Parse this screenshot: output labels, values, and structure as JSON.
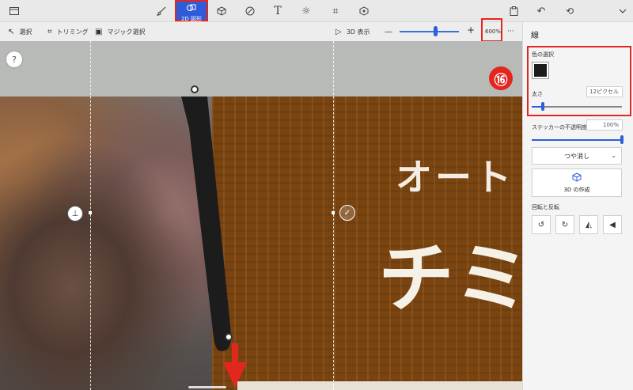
{
  "toolbar": {
    "tab_2d_label": "2D 図形",
    "icons": [
      "menu-icon",
      "brush-icon",
      "2d-shapes-icon",
      "3d-shapes-icon",
      "sticker-icon",
      "text-icon",
      "effects-icon",
      "crop-icon",
      "3d-library-icon",
      "paste-icon",
      "undo-icon",
      "history-icon",
      "expand-icon"
    ]
  },
  "subbar": {
    "select": "選択",
    "trim": "トリミング",
    "magic_select": "マジック選択",
    "view_3d": "3D 表示",
    "zoom_minus": "—",
    "zoom_plus": "+",
    "zoom_value": "600%",
    "more": "···",
    "zoom_level": 0.58
  },
  "canvas": {
    "help": "?",
    "text_oto": "オート",
    "text_chi": "チミ",
    "badge": "⑯"
  },
  "panel": {
    "title": "線",
    "color_label": "色の選択",
    "color_value": "#1c1c1c",
    "thickness_label": "太さ",
    "thickness_value": "12ピクセル",
    "thickness_level": 0.12,
    "opacity_label": "ステッカーの不透明度",
    "opacity_value": "100%",
    "opacity_level": 1.0,
    "finish_value": "つや消し",
    "make3d_label": "3D の作成",
    "rotate_label": "回転と反転"
  },
  "colors": {
    "accent": "#2d5fd6",
    "highlight": "#e2271f"
  }
}
